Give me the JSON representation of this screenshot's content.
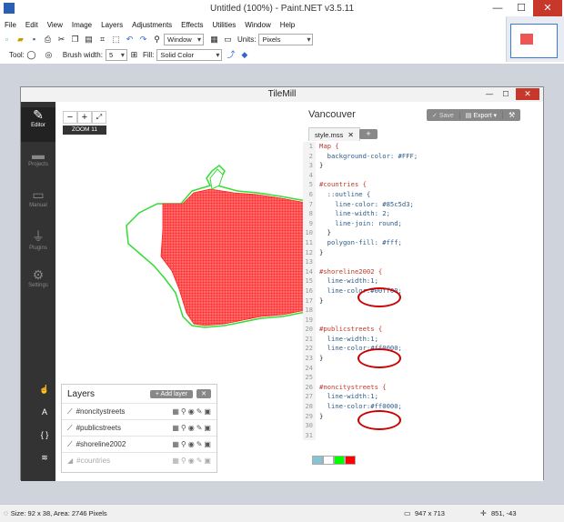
{
  "window": {
    "title": "Untitled (100%) - Paint.NET v3.5.11"
  },
  "menu": [
    "File",
    "Edit",
    "View",
    "Image",
    "Layers",
    "Adjustments",
    "Effects",
    "Utilities",
    "Window",
    "Help"
  ],
  "toolbar": {
    "zoom_value": "Window",
    "units_label": "Units:",
    "units_value": "Pixels",
    "tool_label": "Tool:",
    "brush_label": "Brush width:",
    "brush_value": "5",
    "fill_label": "Fill:",
    "fill_value": "Solid Color"
  },
  "status": {
    "selection": "Size: 92 x 38, Area: 2746 Pixels",
    "image_size": "947 x 713",
    "cursor": "851, -43"
  },
  "tilemill": {
    "title": "TileMill",
    "project": "Vancouver",
    "save_label": "Save",
    "export_label": "Export",
    "tab": "style.mss",
    "zoom_badge": "ZOOM 11",
    "sidebar": [
      {
        "label": "Editor",
        "icon": "pencil-icon"
      },
      {
        "label": "Projects",
        "icon": "folder-icon"
      },
      {
        "label": "Manual",
        "icon": "book-icon"
      },
      {
        "label": "Plugins",
        "icon": "plug-icon"
      },
      {
        "label": "Settings",
        "icon": "gear-icon"
      }
    ],
    "layers_title": "Layers",
    "add_layer_label": "+ Add layer",
    "layers": [
      "#noncitystreets",
      "#publicstreets",
      "#shoreline2002",
      "#countries"
    ],
    "code_lines": [
      "Map {",
      "  background-color: #FFF;",
      "}",
      "",
      "#countries {",
      "  ::outline {",
      "    line-color: #85c5d3;",
      "    line-width: 2;",
      "    line-join: round;",
      "  }",
      "  polygon-fill: #fff;",
      "}",
      "",
      "#shoreline2002 {",
      "  line-width:1;",
      "  line-color:#00ff00;",
      "}",
      "",
      "",
      "#publicstreets {",
      "  line-width:1;",
      "  line-color:#ff0000;",
      "}",
      "",
      "",
      "#noncitystreets {",
      "  line-width:1;",
      "  line-color:#ff0000;",
      "}",
      "",
      ""
    ],
    "swatches": [
      "#85c5d3",
      "#ffffff",
      "#00ff00",
      "#ff0000"
    ],
    "map_colors": {
      "streets": "#ff3333",
      "shoreline": "#33dd33"
    }
  }
}
